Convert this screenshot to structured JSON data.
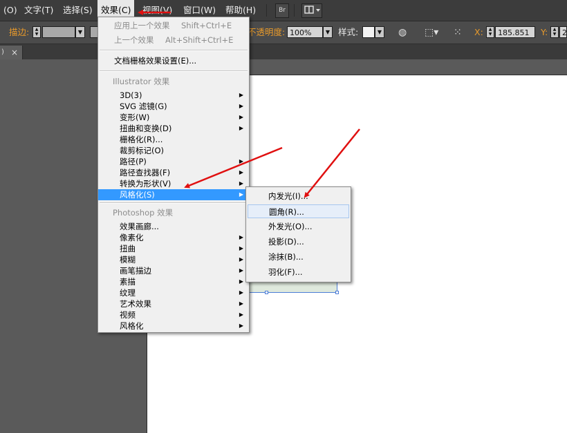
{
  "menubar": {
    "items": [
      "(O)",
      "文字(T)",
      "选择(S)",
      "效果(C)",
      "视图(V)",
      "窗口(W)",
      "帮助(H)"
    ],
    "bridge_label": "Br"
  },
  "control_bar": {
    "stroke_label": "描边:",
    "opacity_label": "不透明度:",
    "opacity_value": "100%",
    "style_label": "样式:",
    "x_label": "X:",
    "x_value": "185.851",
    "y_label": "Y:",
    "y_value_partial": "2"
  },
  "tab": {
    "close_glyph": "×"
  },
  "effect_menu": {
    "apply_last": "应用上一个效果",
    "apply_last_shortcut": "Shift+Ctrl+E",
    "last_effect": "上一个效果",
    "last_effect_shortcut": "Alt+Shift+Ctrl+E",
    "raster_settings": "文档栅格效果设置(E)...",
    "illustrator_section": "Illustrator 效果",
    "illustrator_items": [
      "3D(3)",
      "SVG 滤镜(G)",
      "变形(W)",
      "扭曲和变换(D)",
      "栅格化(R)...",
      "裁剪标记(O)",
      "路径(P)",
      "路径查找器(F)",
      "转换为形状(V)",
      "风格化(S)"
    ],
    "photoshop_section": "Photoshop 效果",
    "photoshop_items": [
      "效果画廊...",
      "像素化",
      "扭曲",
      "模糊",
      "画笔描边",
      "素描",
      "纹理",
      "艺术效果",
      "视频",
      "风格化"
    ]
  },
  "stylize_submenu": {
    "items": [
      "内发光(I)...",
      "圆角(R)...",
      "外发光(O)...",
      "投影(D)...",
      "涂抹(B)...",
      "羽化(F)..."
    ]
  },
  "colors": {
    "highlight": "#3399ff",
    "annotation_arrow": "#e01010",
    "stroke_label": "#e89a2b"
  }
}
